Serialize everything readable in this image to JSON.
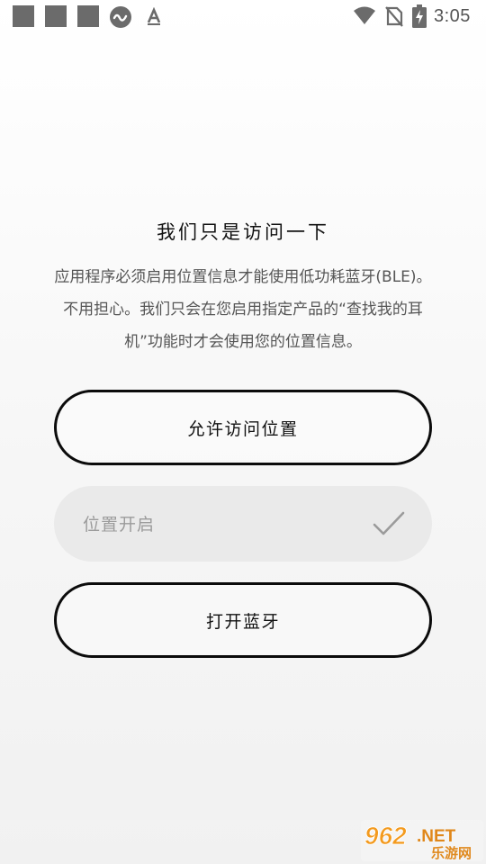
{
  "status_bar": {
    "time": "3:05",
    "icons": [
      "placeholder-square-icon",
      "placeholder-square-icon",
      "placeholder-square-icon",
      "circle-app-icon",
      "a-letter-icon",
      "wifi-icon",
      "no-sim-icon",
      "battery-charging-icon"
    ]
  },
  "content": {
    "title": "我们只是访问一下",
    "description": "应用程序必须启用位置信息才能使用低功耗蓝牙(BLE)。不用担心。我们只会在您启用指定产品的“查找我的耳机”功能时才会使用您的位置信息。"
  },
  "buttons": {
    "allow_location": "允许访问位置",
    "open_bluetooth": "打开蓝牙"
  },
  "location_status": {
    "label": "位置开启"
  },
  "watermark": {
    "brand_number": "962",
    "brand_suffix": ".NET",
    "brand_cn": "乐游网"
  },
  "colors": {
    "button_border": "#0b0b0b",
    "status_pill_bg": "#eaeaea",
    "muted_text": "#9b9b9b",
    "watermark_orange": "#f39a1e"
  }
}
